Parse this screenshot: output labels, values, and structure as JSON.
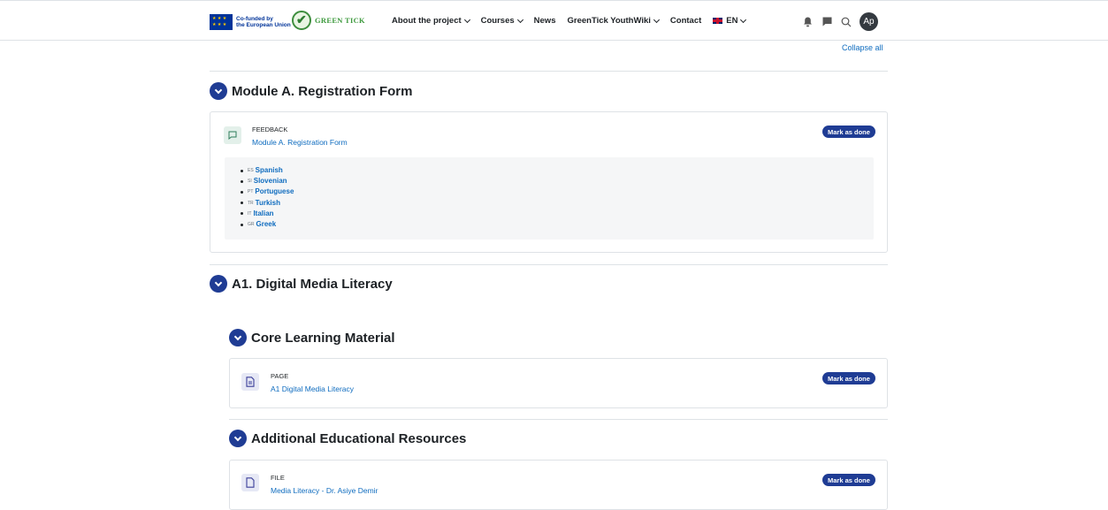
{
  "nav": {
    "eu_line1": "Co-funded by",
    "eu_line2": "the European Union",
    "brand": "GREEN TICK",
    "items": [
      "About the project",
      "Courses",
      "News",
      "GreenTick YouthWiki",
      "Contact"
    ],
    "lang": "EN",
    "avatar": "Ap",
    "icons": [
      "bell-icon",
      "chat-icon",
      "search-icon"
    ]
  },
  "collapse_all": "Collapse all",
  "sections": {
    "module_a": {
      "title": "Module A. Registration Form",
      "activity": {
        "type": "FEEDBACK",
        "name": "Module A. Registration Form",
        "button": "Mark as done",
        "icon": "feedback-icon"
      },
      "languages": [
        {
          "code": "ES",
          "label": "Spanish"
        },
        {
          "code": "SI",
          "label": "Slovenian"
        },
        {
          "code": "PT",
          "label": "Portuguese"
        },
        {
          "code": "TR",
          "label": "Turkish"
        },
        {
          "code": "IT",
          "label": "Italian"
        },
        {
          "code": "GR",
          "label": "Greek"
        }
      ]
    },
    "a1": {
      "title": "A1. Digital Media Literacy"
    },
    "core": {
      "title": "Core Learning Material",
      "activity": {
        "type": "PAGE",
        "name": "A1 Digital Media Literacy",
        "button": "Mark as done",
        "icon": "page-icon"
      }
    },
    "additional": {
      "title": "Additional Educational Resources",
      "activity": {
        "type": "FILE",
        "name": "Media Literacy - Dr. Asiye Demir",
        "button": "Mark as done",
        "icon": "file-icon"
      }
    }
  },
  "colors": {
    "accent": "#1f3c94",
    "link": "#0f6cbf",
    "feedback_bg": "#e3f0ea",
    "page_bg": "#e6e8f5"
  }
}
